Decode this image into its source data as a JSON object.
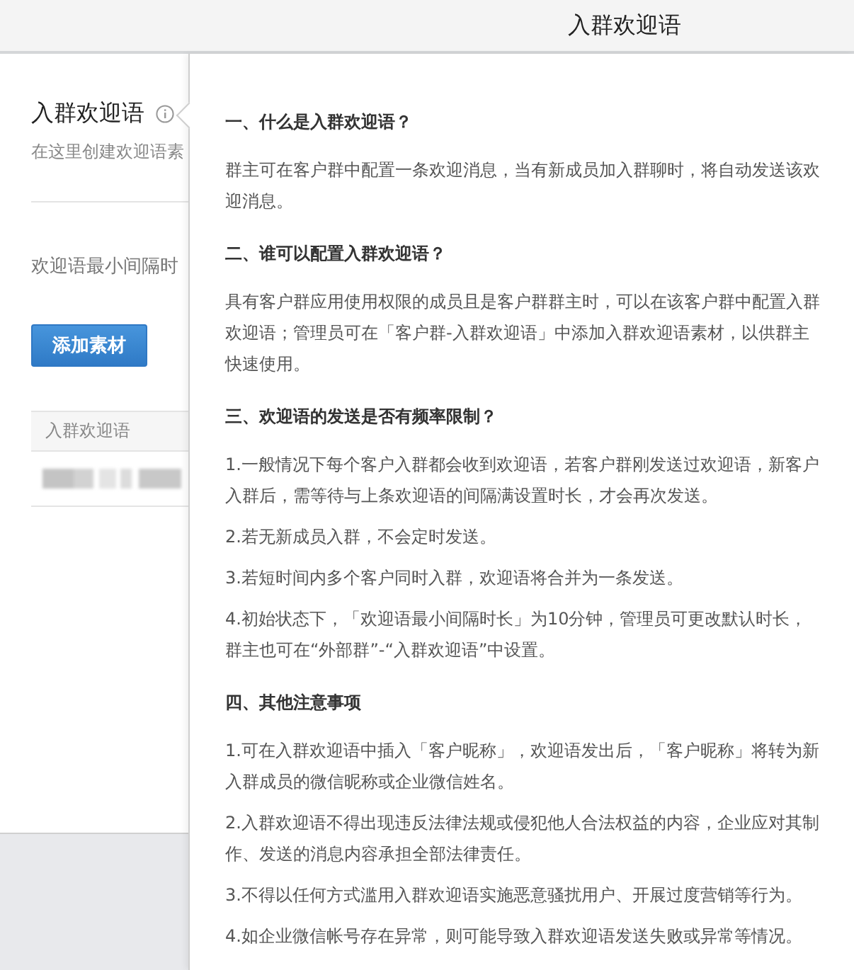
{
  "header": {
    "title": "入群欢迎语"
  },
  "page": {
    "title": "入群欢迎语",
    "subtitle": "在这里创建欢迎语素",
    "interval_label": "欢迎语最小间隔时",
    "add_button": "添加素材",
    "table": {
      "columns": [
        "入群欢迎语"
      ],
      "rows": [
        {
          "kind": "redacted"
        }
      ]
    }
  },
  "popover": {
    "sections": [
      {
        "heading": "一、什么是入群欢迎语？",
        "paragraphs": [
          "群主可在客户群中配置一条欢迎消息，当有新成员加入群聊时，将自动发送该欢迎消息。"
        ]
      },
      {
        "heading": "二、谁可以配置入群欢迎语？",
        "paragraphs": [
          "具有客户群应用使用权限的成员且是客户群群主时，可以在该客户群中配置入群欢迎语；管理员可在「客户群-入群欢迎语」中添加入群欢迎语素材，以供群主快速使用。"
        ]
      },
      {
        "heading": "三、欢迎语的发送是否有频率限制？",
        "paragraphs": [
          "1.一般情况下每个客户入群都会收到欢迎语，若客户群刚发送过欢迎语，新客户入群后，需等待与上条欢迎语的间隔满设置时长，才会再次发送。",
          "2.若无新成员入群，不会定时发送。",
          "3.若短时间内多个客户同时入群，欢迎语将合并为一条发送。",
          "4.初始状态下，「欢迎语最小间隔时长」为10分钟，管理员可更改默认时长，群主也可在“外部群”-“入群欢迎语”中设置。"
        ]
      },
      {
        "heading": "四、其他注意事项",
        "paragraphs": [
          "1.可在入群欢迎语中插入「客户昵称」，欢迎语发出后，「客户昵称」将转为新入群成员的微信昵称或企业微信姓名。",
          "2.入群欢迎语不得出现违反法律法规或侵犯他人合法权益的内容，企业应对其制作、发送的消息内容承担全部法律责任。",
          "3.不得以任何方式滥用入群欢迎语实施恶意骚扰用户、开展过度营销等行为。",
          "4.如企业微信帐号存在异常，则可能导致入群欢迎语发送失败或异常等情况。"
        ]
      }
    ]
  }
}
